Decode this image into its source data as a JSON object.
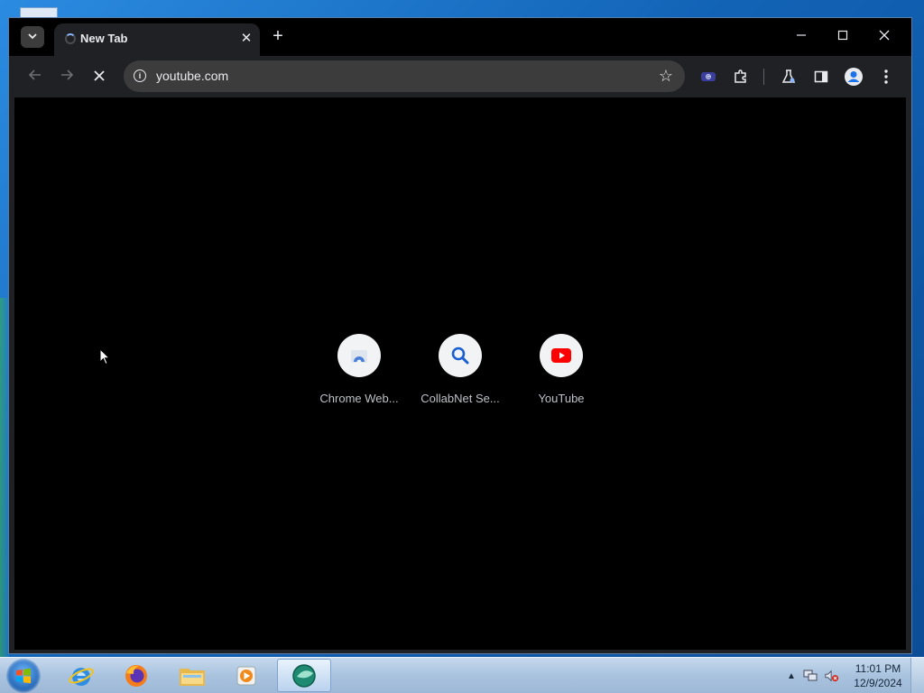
{
  "tab": {
    "title": "New Tab"
  },
  "omnibox": {
    "url": "youtube.com"
  },
  "shortcuts": [
    {
      "label": "Chrome Web...",
      "icon": "chrome-web-store-icon"
    },
    {
      "label": "CollabNet Se...",
      "icon": "magnifier-icon"
    },
    {
      "label": "YouTube",
      "icon": "youtube-icon"
    }
  ],
  "taskbar": {
    "apps": [
      "internet-explorer-icon",
      "firefox-icon",
      "file-explorer-icon",
      "media-player-icon",
      "app-icon"
    ],
    "clock_time": "11:01 PM",
    "clock_date": "12/9/2024"
  },
  "colors": {
    "accent": "#8ab4f8",
    "youtube_red": "#ff0000",
    "search_blue": "#1a5fd1"
  }
}
